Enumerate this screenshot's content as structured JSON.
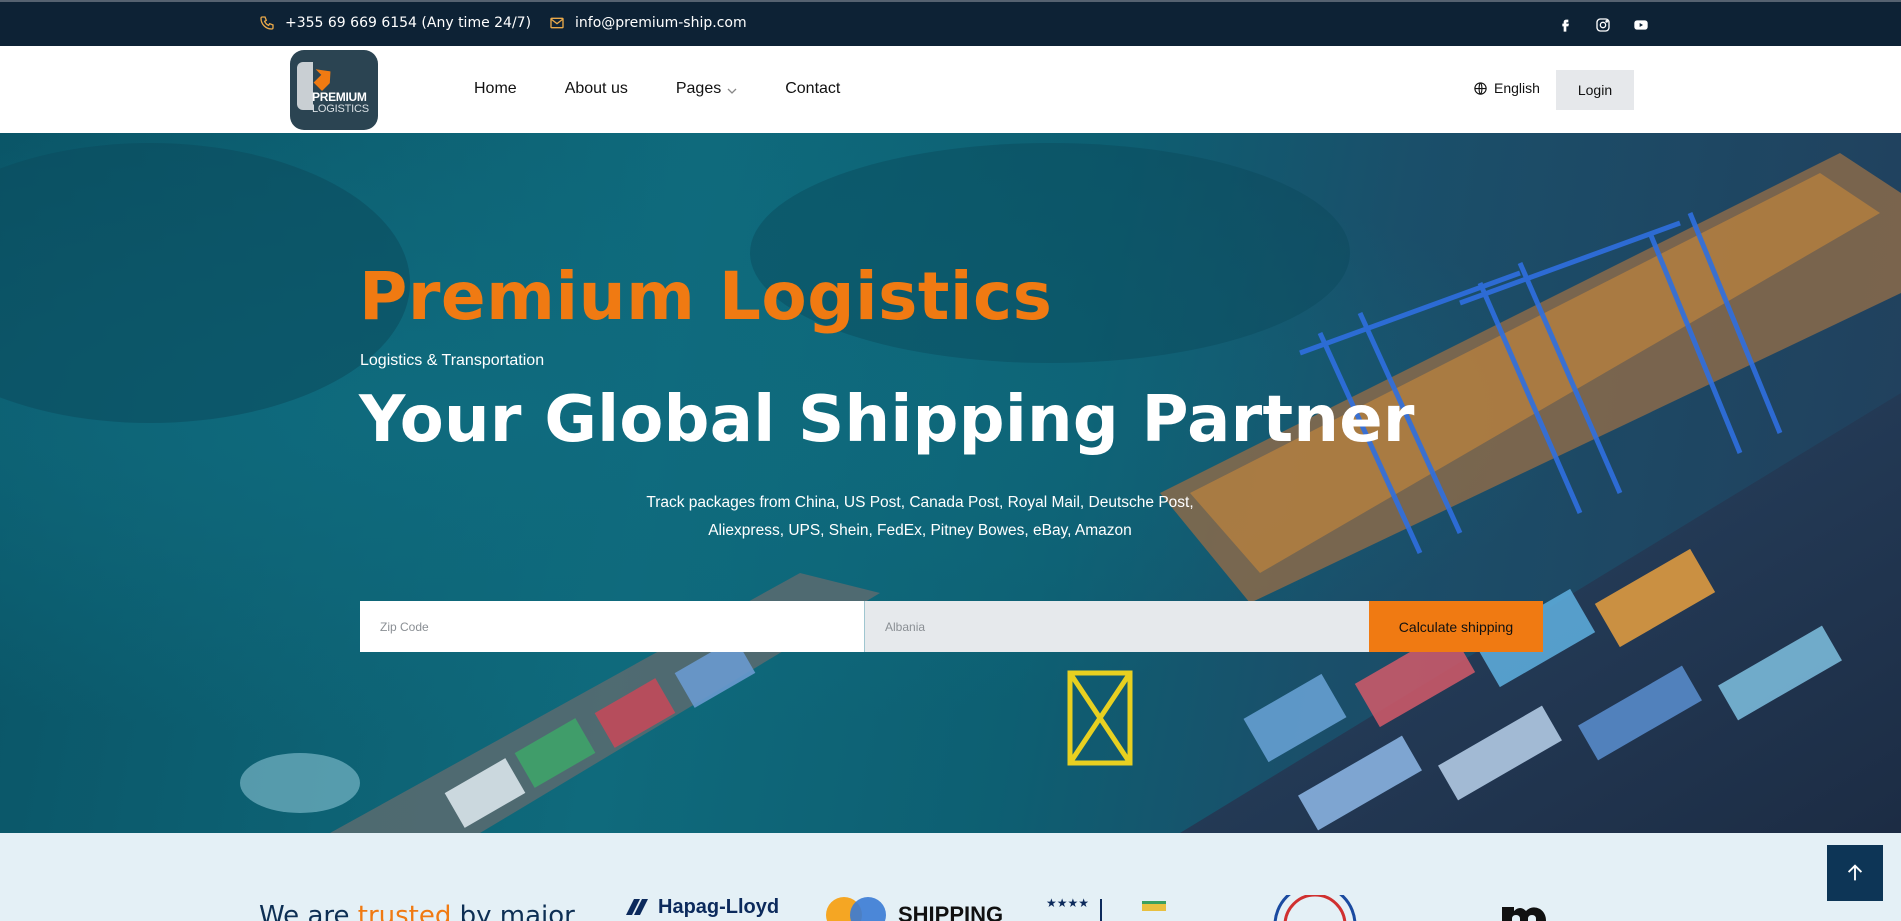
{
  "topbar": {
    "phone": "+355 69 669 6154 (Any time 24/7)",
    "email": "info@premium-ship.com",
    "phone_icon": "phone-icon",
    "email_icon": "mail-icon",
    "social": [
      "facebook-icon",
      "instagram-icon",
      "youtube-icon"
    ]
  },
  "header": {
    "logo_line1": "PREMIUM",
    "logo_line2": "LOGISTICS",
    "nav": {
      "home": "Home",
      "about": "About us",
      "pages": "Pages",
      "contact": "Contact"
    },
    "language": "English",
    "login": "Login"
  },
  "hero": {
    "title": "Premium Logistics",
    "subtitle": "Logistics & Transportation",
    "headline": "Your Global Shipping Partner",
    "desc_line1": "Track packages from China, US Post, Canada Post, Royal Mail, Deutsche Post,",
    "desc_line2": "Aliexpress, UPS, Shein, FedEx, Pitney Bowes, eBay, Amazon",
    "zip_placeholder": "Zip Code",
    "country_placeholder": "Albania",
    "calc_button": "Calculate shipping"
  },
  "trusted": {
    "prefix": "We are ",
    "highlight": "trusted",
    "suffix": " by major",
    "partner1": "Hapag-Lloyd",
    "partner2": "SHIPPING"
  },
  "colors": {
    "accent": "#f07a12",
    "topbar_bg": "#0d2235",
    "navy": "#0d3556",
    "trusted_bg": "#e4f0f6"
  }
}
